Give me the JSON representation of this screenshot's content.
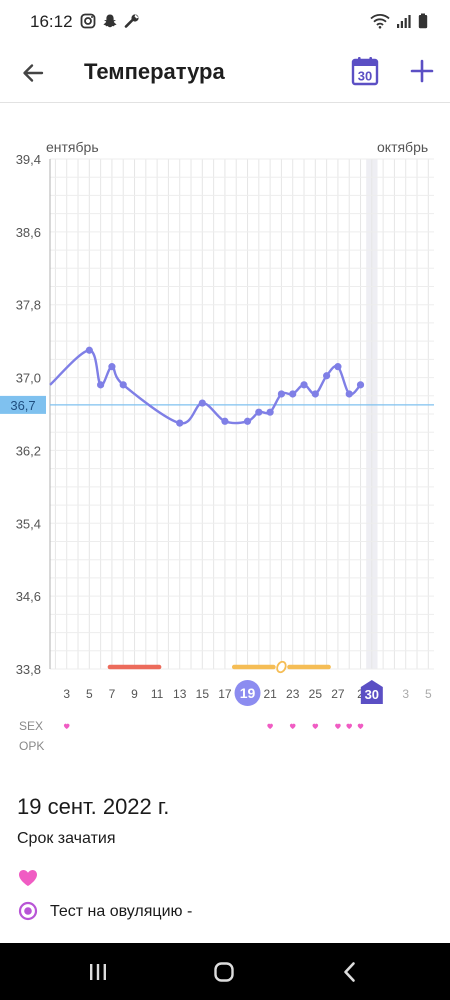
{
  "status_bar": {
    "time": "16:12"
  },
  "app_bar": {
    "title": "Температура",
    "calendar_day": "30"
  },
  "chart_data": {
    "type": "line",
    "month_labels": [
      "ентябрь",
      "октябрь"
    ],
    "y_ticks": [
      "39,4",
      "38,6",
      "37,8",
      "37,0",
      "36,2",
      "35,4",
      "34,6",
      "33,8"
    ],
    "ylim": [
      33.8,
      39.4
    ],
    "coverline": {
      "value": 36.7,
      "label": "36,7"
    },
    "x_ticks": [
      "3",
      "5",
      "7",
      "9",
      "11",
      "13",
      "15",
      "17",
      "19",
      "21",
      "23",
      "25",
      "27",
      "2",
      "30",
      "3",
      "5"
    ],
    "selected_day": "19",
    "today_day": "30",
    "points": [
      {
        "day": "5 сент.",
        "value": 37.3
      },
      {
        "day": "6 сент.",
        "value": 36.92
      },
      {
        "day": "7 сент.",
        "value": 37.12
      },
      {
        "day": "8 сент.",
        "value": 36.92
      },
      {
        "day": "13 сент.",
        "value": 36.5
      },
      {
        "day": "15 сент.",
        "value": 36.72
      },
      {
        "day": "17 сент.",
        "value": 36.52
      },
      {
        "day": "19 сент.",
        "value": 36.52
      },
      {
        "day": "20 сент.",
        "value": 36.62
      },
      {
        "day": "21 сент.",
        "value": 36.62
      },
      {
        "day": "22 сент.",
        "value": 36.82
      },
      {
        "day": "23 сент.",
        "value": 36.82
      },
      {
        "day": "24 сент.",
        "value": 36.92
      },
      {
        "day": "25 сент.",
        "value": 36.82
      },
      {
        "day": "26 сент.",
        "value": 37.02
      },
      {
        "day": "27 сент.",
        "value": 37.12
      },
      {
        "day": "28 сент.",
        "value": 36.82
      },
      {
        "day": "29 сент.",
        "value": 36.92
      }
    ],
    "row_labels": [
      "SEX",
      "OPK"
    ],
    "sex_days": [
      "3",
      "21",
      "23",
      "25",
      "27",
      "28",
      "29"
    ],
    "period_days": [
      "7",
      "8",
      "9",
      "10",
      "11"
    ],
    "fertile_days": [
      "18",
      "19",
      "20",
      "21",
      "22",
      "23",
      "24",
      "25",
      "26"
    ],
    "ovulation_day": "22"
  },
  "details": {
    "date": "19 сент. 2022 г.",
    "phase": "Срок зачатия",
    "opk_text": "Тест на овуляцию -"
  },
  "colors": {
    "accent": "#5b4fc4",
    "line": "#7f7fe6",
    "selected": "#8c8cf0",
    "period": "#ec6b5b",
    "fertile": "#f5bd55",
    "sex": "#f05cc3",
    "coverline": "#7fc1ef"
  },
  "icons": [
    "instagram-icon",
    "snapchat-icon",
    "wrench-icon",
    "wifi-icon",
    "signal-icon",
    "battery-icon",
    "back-arrow-icon",
    "calendar-icon",
    "plus-icon",
    "heart-icon",
    "ovulation-test-icon",
    "recents-icon",
    "home-icon",
    "nav-back-icon"
  ]
}
